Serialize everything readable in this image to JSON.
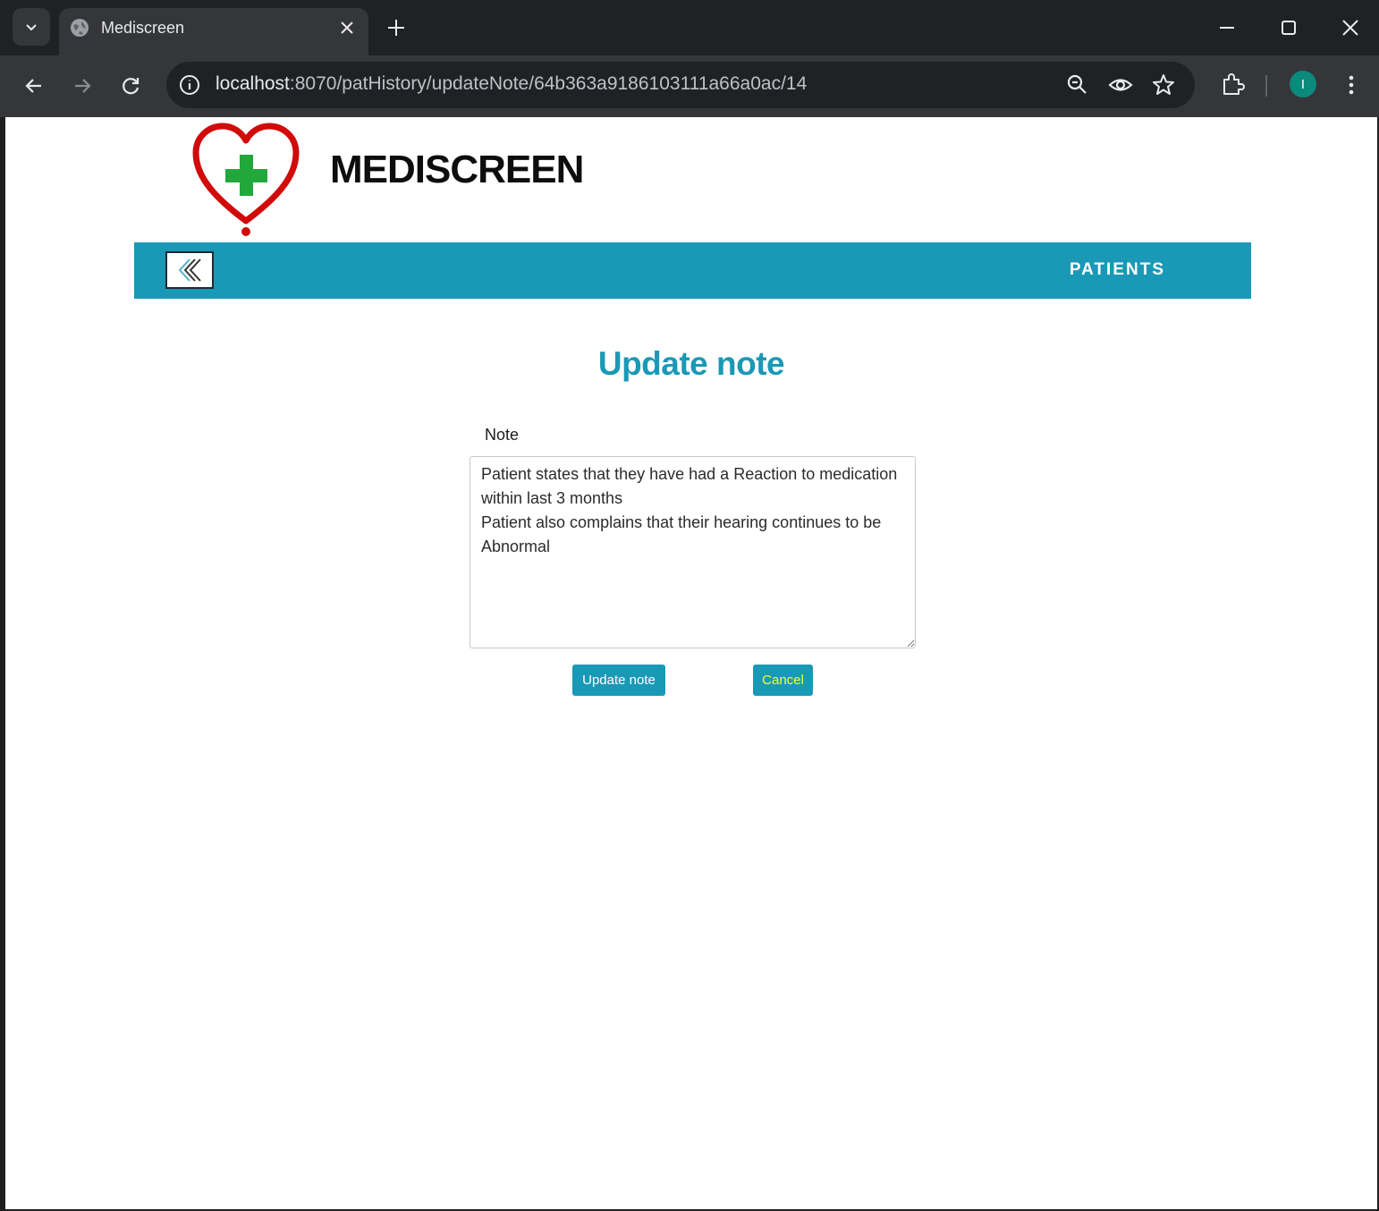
{
  "browser": {
    "tab_title": "Mediscreen",
    "url_host": "localhost",
    "url_rest": ":8070/patHistory/updateNote/64b363a9186103111a66a0ac/14",
    "profile_initial": "I"
  },
  "header": {
    "brand": "MEDISCREEN",
    "nav_patients": "PATIENTS"
  },
  "form": {
    "title": "Update note",
    "note_label": "Note",
    "note_value": "Patient states that they have had a Reaction to medication within last 3 months\nPatient also complains that their hearing continues to be Abnormal",
    "update_label": "Update note",
    "cancel_label": "Cancel"
  },
  "colors": {
    "accent": "#1a99b6",
    "cancel_text": "#ecff3c",
    "logo_heart": "#d10a0a",
    "logo_cross": "#22a83a"
  }
}
